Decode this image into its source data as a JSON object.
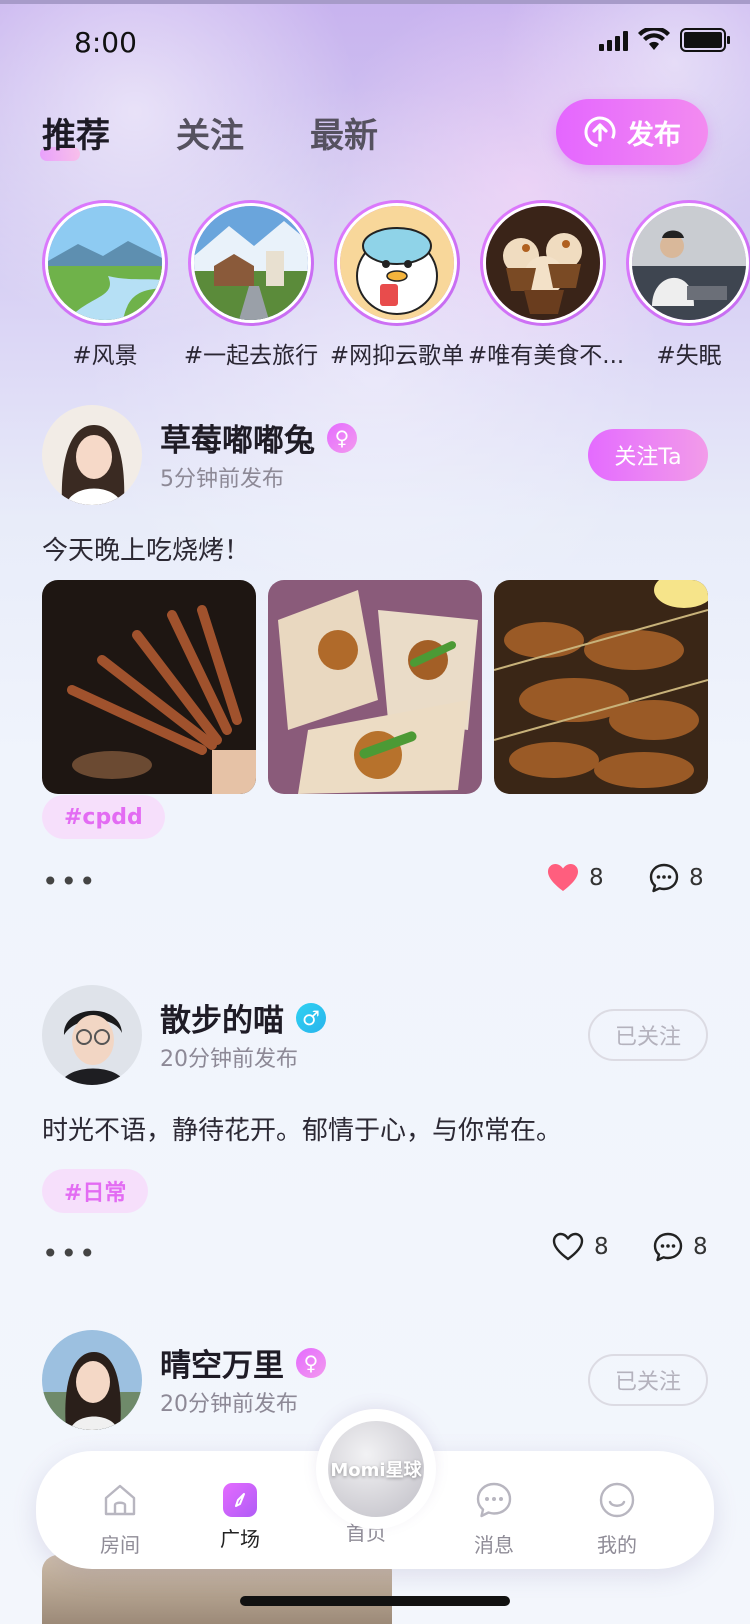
{
  "status_bar": {
    "time": "8:00"
  },
  "tabs": [
    {
      "label": "推荐",
      "active": true
    },
    {
      "label": "关注",
      "active": false
    },
    {
      "label": "最新",
      "active": false
    }
  ],
  "publish": {
    "label": "发布",
    "icon": "upload-circle-icon"
  },
  "topics": [
    {
      "label": "#风景",
      "image": "landscape-lake"
    },
    {
      "label": "#一起去旅行",
      "image": "mountain-house"
    },
    {
      "label": "#网抑云歌单",
      "image": "cartoon-duck"
    },
    {
      "label": "#唯有美食不...",
      "image": "cupcakes"
    },
    {
      "label": "#失眠",
      "image": "person-sitting"
    }
  ],
  "posts": [
    {
      "username": "草莓嘟嘟兔",
      "gender": "♀",
      "time": "5分钟前发布",
      "follow_label": "关注Ta",
      "text": "今天晚上吃烧烤！",
      "tag": "#cpdd",
      "likes": "8",
      "comments": "8",
      "liked": true,
      "photos": [
        "bbq-skewers-dark",
        "wraps-skewers",
        "grilled-skewers-tray"
      ]
    },
    {
      "username": "散步的喵",
      "gender": "♂",
      "time": "20分钟前发布",
      "follow_label": "已关注",
      "text": "时光不语，静待花开。郁情于心，与你常在。",
      "tag": "#日常",
      "likes": "8",
      "comments": "8",
      "liked": false
    },
    {
      "username": "晴空万里",
      "gender": "♀",
      "time": "20分钟前发布",
      "follow_label": "已关注"
    }
  ],
  "more_label": "•••",
  "nav": {
    "items": [
      {
        "label": "房间",
        "icon": "house-icon"
      },
      {
        "label": "广场",
        "icon": "square-compass-icon",
        "active": true
      },
      {
        "label": "首页",
        "icon": "home-logo-icon"
      },
      {
        "label": "消息",
        "icon": "chat-bubble-icon"
      },
      {
        "label": "我的",
        "icon": "smiley-icon"
      }
    ],
    "center_logo": "Momi星球"
  },
  "colors": {
    "accent": "#e46bff",
    "male": "#2fc6f0",
    "like": "#ff5a7a"
  }
}
